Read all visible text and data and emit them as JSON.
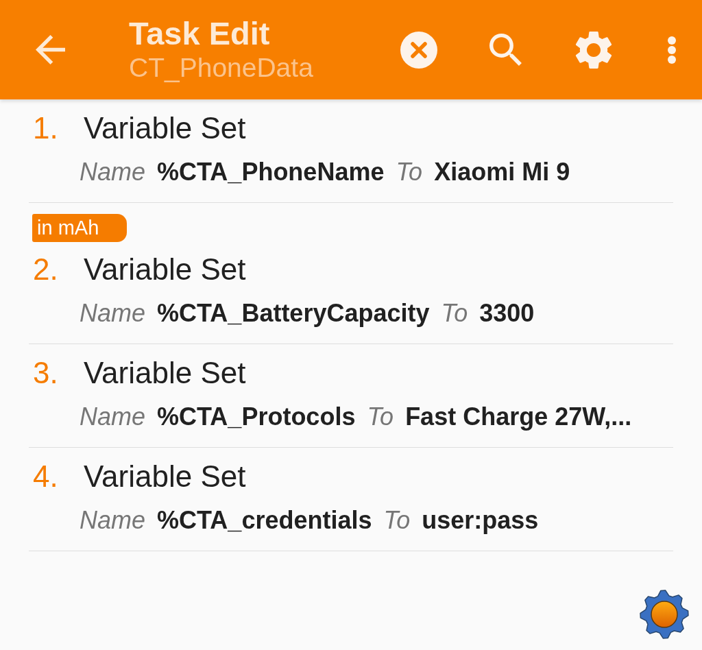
{
  "header": {
    "title": "Task Edit",
    "subtitle": "CT_PhoneData"
  },
  "actions": [
    {
      "number": "1.",
      "title": "Variable Set",
      "params": [
        {
          "key": "Name",
          "value": "%CTA_PhoneName"
        },
        {
          "key": "To",
          "value": "Xiaomi Mi 9"
        }
      ]
    },
    {
      "label": "in mAh",
      "number": "2.",
      "title": "Variable Set",
      "params": [
        {
          "key": "Name",
          "value": "%CTA_BatteryCapacity"
        },
        {
          "key": "To",
          "value": "3300"
        }
      ]
    },
    {
      "number": "3.",
      "title": "Variable Set",
      "params": [
        {
          "key": "Name",
          "value": "%CTA_Protocols"
        },
        {
          "key": "To",
          "value": "Fast Charge 27W,..."
        }
      ]
    },
    {
      "number": "4.",
      "title": "Variable Set",
      "params": [
        {
          "key": "Name",
          "value": "%CTA_credentials"
        },
        {
          "key": "To",
          "value": "user:pass"
        }
      ]
    }
  ]
}
